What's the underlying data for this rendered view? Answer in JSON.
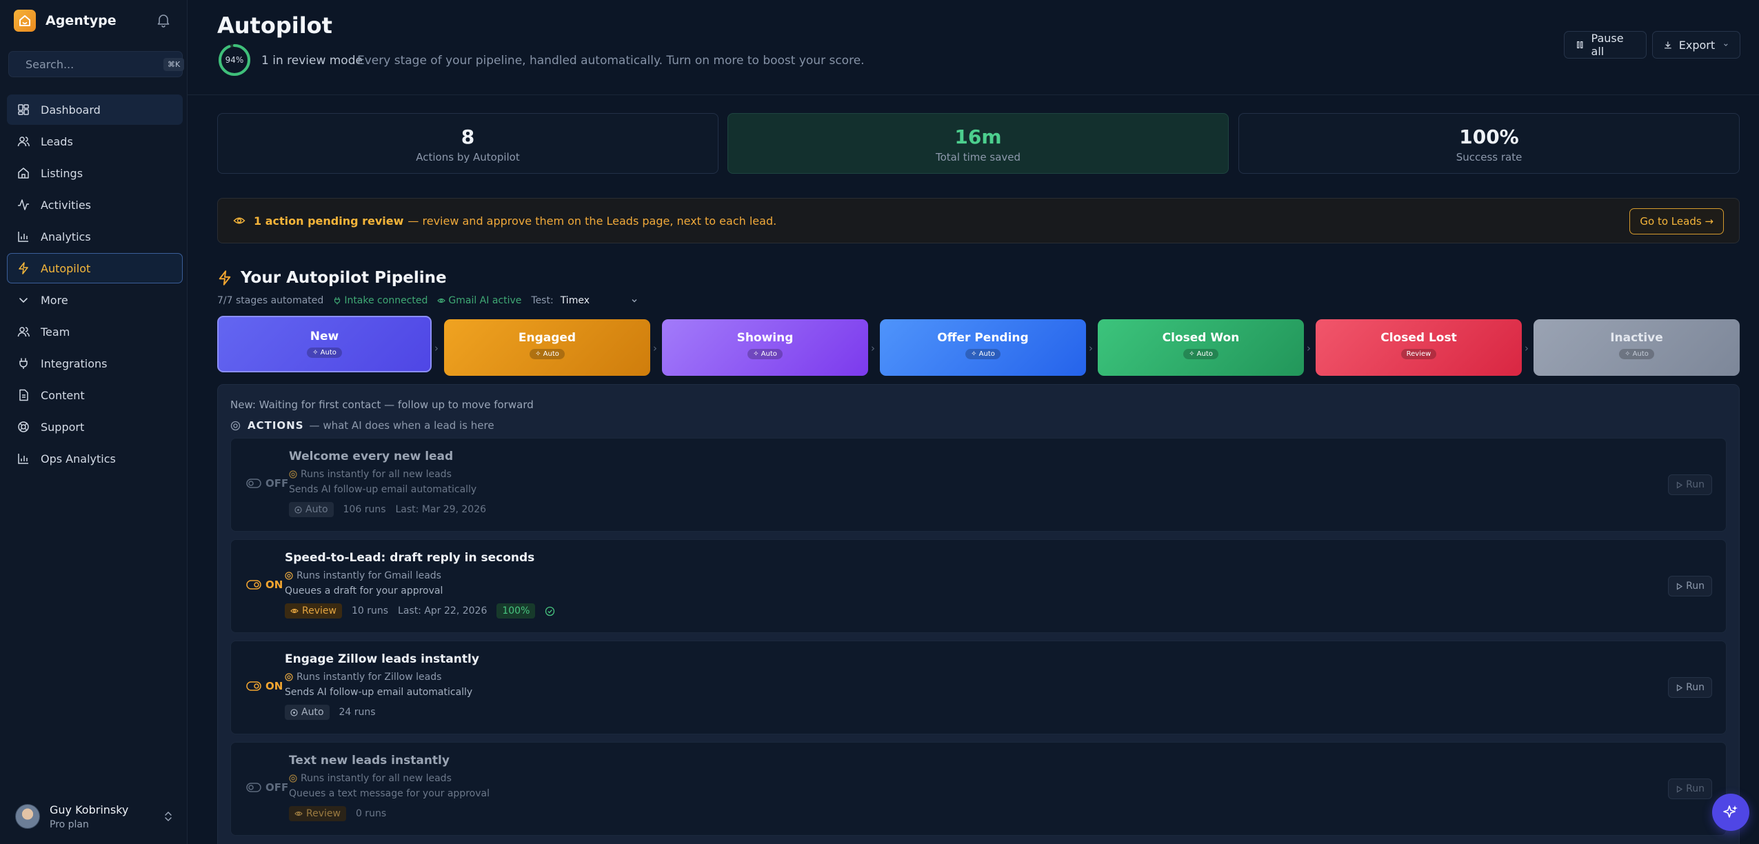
{
  "app": {
    "name": "Agentype"
  },
  "search": {
    "placeholder": "Search...",
    "shortcut": "⌘K"
  },
  "sidebar": {
    "items": [
      {
        "label": "Dashboard",
        "icon": "dashboard-icon"
      },
      {
        "label": "Leads",
        "icon": "users-icon"
      },
      {
        "label": "Listings",
        "icon": "home-icon"
      },
      {
        "label": "Activities",
        "icon": "activity-icon"
      },
      {
        "label": "Analytics",
        "icon": "bar-chart-icon"
      },
      {
        "label": "Autopilot",
        "icon": "bolt-icon"
      },
      {
        "label": "More",
        "icon": "chevron-down-icon"
      },
      {
        "label": "Team",
        "icon": "team-icon"
      },
      {
        "label": "Integrations",
        "icon": "plug-icon"
      },
      {
        "label": "Content",
        "icon": "document-icon"
      },
      {
        "label": "Support",
        "icon": "lifebuoy-icon"
      },
      {
        "label": "Ops Analytics",
        "icon": "bar-chart-icon"
      }
    ]
  },
  "user": {
    "name": "Guy Kobrinsky",
    "plan": "Pro plan"
  },
  "header": {
    "title": "Autopilot",
    "score": "94%",
    "score_value": 0.94,
    "review_mode": "1 in review mode",
    "description": "Every stage of your pipeline, handled automatically. Turn on more to boost your score.",
    "pause_label": "Pause all",
    "export_label": "Export"
  },
  "stats": [
    {
      "value": "8",
      "label": "Actions by Autopilot"
    },
    {
      "value": "16m",
      "label": "Total time saved"
    },
    {
      "value": "100%",
      "label": "Success rate"
    }
  ],
  "banner": {
    "strong": "1 action pending review",
    "text": "— review and approve them on the Leads page, next to each lead.",
    "button": "Go to Leads →"
  },
  "pipeline": {
    "title": "Your Autopilot Pipeline",
    "automated": "7/7 stages automated",
    "intake": "Intake connected",
    "gmail": "Gmail AI active",
    "test_label": "Test:",
    "test_value": "Timex",
    "stages": [
      {
        "name": "New",
        "badge": "Auto"
      },
      {
        "name": "Engaged",
        "badge": "Auto"
      },
      {
        "name": "Showing",
        "badge": "Auto"
      },
      {
        "name": "Offer Pending",
        "badge": "Auto"
      },
      {
        "name": "Closed Won",
        "badge": "Auto"
      },
      {
        "name": "Closed Lost",
        "badge": "Review"
      },
      {
        "name": "Inactive",
        "badge": "Auto"
      }
    ],
    "colors": {
      "new": "#5b5ef0",
      "engaged": "#ea9a16",
      "showing": "#8b5cf6",
      "offer_pending": "#3b82f6",
      "closed_won": "#2fae6a",
      "closed_lost": "#e23b55",
      "inactive": "#8a94a6"
    }
  },
  "panel": {
    "stage_desc": "New: Waiting for first contact — follow up to move forward",
    "actions_title": "ACTIONS",
    "actions_sub": "— what AI does when a lead is here"
  },
  "actions": [
    {
      "state": "OFF",
      "title": "Welcome every new lead",
      "trigger": "Runs instantly for all new leads",
      "desc": "Sends AI follow-up email automatically",
      "mode": "Auto",
      "runs": "106 runs",
      "last": "Last: Mar 29, 2026",
      "run_label": "Run"
    },
    {
      "state": "ON",
      "title": "Speed-to-Lead: draft reply in seconds",
      "trigger": "Runs instantly for Gmail leads",
      "desc": "Queues a draft for your approval",
      "mode": "Review",
      "runs": "10 runs",
      "last": "Last: Apr 22, 2026",
      "success": "100%",
      "run_label": "Run"
    },
    {
      "state": "ON",
      "title": "Engage Zillow leads instantly",
      "trigger": "Runs instantly for Zillow leads",
      "desc": "Sends AI follow-up email automatically",
      "mode": "Auto",
      "runs": "24 runs",
      "run_label": "Run"
    },
    {
      "state": "OFF",
      "title": "Text new leads instantly",
      "trigger": "Runs instantly for all new leads",
      "desc": "Queues a text message for your approval",
      "mode": "Review",
      "runs": "0 runs",
      "run_label": "Run"
    }
  ]
}
